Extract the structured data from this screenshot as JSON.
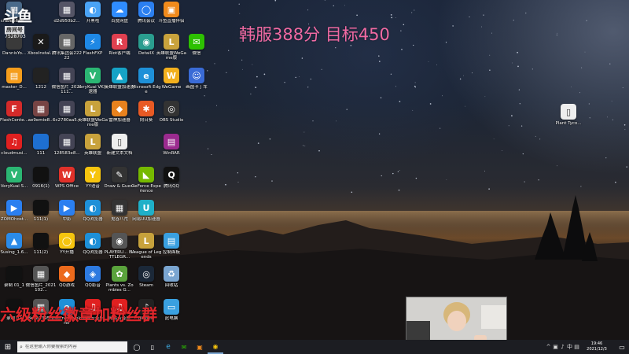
{
  "overlay": {
    "logo_text": "斗鱼",
    "room_label": "房间号",
    "room_id": "7528703",
    "rank_goal": "韩服388分  目标450",
    "fan_group": "六级粉丝徽章加粉丝群"
  },
  "desktop_icons": [
    {
      "label": "Dannis",
      "glyph": "",
      "color": "#3a3a3a"
    },
    {
      "label": "d2d950b2...",
      "glyph": "▦",
      "color": "#556"
    },
    {
      "label": "开黑啦",
      "glyph": "◐",
      "color": "#4aa3f5"
    },
    {
      "label": "百度网盘",
      "glyph": "☁",
      "color": "#2f8cff"
    },
    {
      "label": "腾讯会议",
      "glyph": "◯",
      "color": "#2b7ff0"
    },
    {
      "label": "斗鱼直播伴侣",
      "glyph": "▣",
      "color": "#f08a1c"
    },
    {
      "label": "DannisYo...",
      "glyph": "",
      "color": "#3a3a3a"
    },
    {
      "label": "XboxInstal...",
      "glyph": "✕",
      "color": "#1a1a1a"
    },
    {
      "label": "腾讯集团会22222",
      "glyph": "▦",
      "color": "#666"
    },
    {
      "label": "FlashFXP",
      "glyph": "⚡",
      "color": "#1e88e5"
    },
    {
      "label": "Riot客户端",
      "glyph": "R",
      "color": "#e04050"
    },
    {
      "label": "DetailX",
      "glyph": "◉",
      "color": "#2a9d8f"
    },
    {
      "label": "英雄联盟WeGame版",
      "glyph": "L",
      "color": "#c8a23c"
    },
    {
      "label": "微信",
      "glyph": "✉",
      "color": "#2dc100"
    },
    {
      "label": "master_D...",
      "glyph": "▤",
      "color": "#f59d1c"
    },
    {
      "label": "1212",
      "glyph": "",
      "color": "#222"
    },
    {
      "label": "微信图片_2021111...",
      "glyph": "▦",
      "color": "#445"
    },
    {
      "label": "VeryKuai VK加速器",
      "glyph": "V",
      "color": "#2bb673"
    },
    {
      "label": "英雄联盟加速器",
      "glyph": "▲",
      "color": "#16a3c6"
    },
    {
      "label": "Microsoft Edge",
      "glyph": "e",
      "color": "#1e90d8"
    },
    {
      "label": "WeGame",
      "glyph": "W",
      "color": "#f2b01e"
    },
    {
      "label": "画图卡丁车",
      "glyph": "☺",
      "color": "#3a6bd6"
    },
    {
      "label": "FlashCente...",
      "glyph": "F",
      "color": "#d42a2a"
    },
    {
      "label": "ae9emie8...",
      "glyph": "▦",
      "color": "#744"
    },
    {
      "label": "6c2780aa5...",
      "glyph": "▦",
      "color": "#445"
    },
    {
      "label": "英雄联盟WeGame版",
      "glyph": "L",
      "color": "#c8a23c"
    },
    {
      "label": "雷神加速器",
      "glyph": "◆",
      "color": "#e8821e"
    },
    {
      "label": "向日葵",
      "glyph": "✱",
      "color": "#e85a24"
    },
    {
      "label": "OBS Studio",
      "glyph": "◎",
      "color": "#333"
    },
    {
      "label": "cloudmusi...",
      "glyph": "♫",
      "color": "#e02020"
    },
    {
      "label": "111",
      "glyph": "",
      "color": "#1e6fd0"
    },
    {
      "label": "128583e8...",
      "glyph": "▦",
      "color": "#445"
    },
    {
      "label": "英雄联盟",
      "glyph": "L",
      "color": "#c8a23c"
    },
    {
      "label": "新建文本文档",
      "glyph": "▯",
      "color": "#eee"
    },
    {
      "label": "WinRAR",
      "glyph": "▤",
      "color": "#9b2b8f"
    },
    {
      "label": "VeryKuai S...",
      "glyph": "V",
      "color": "#2bb673"
    },
    {
      "label": "0916(1)",
      "glyph": "",
      "color": "#111"
    },
    {
      "label": "WPS Office",
      "glyph": "W",
      "color": "#e0312a"
    },
    {
      "label": "YY语音",
      "glyph": "Y",
      "color": "#f6c40e"
    },
    {
      "label": "Draw & Guess",
      "glyph": "✎",
      "color": "#333"
    },
    {
      "label": "GeForce Experience",
      "glyph": "◣",
      "color": "#76b900"
    },
    {
      "label": "腾讯QQ",
      "glyph": "Q",
      "color": "#111"
    },
    {
      "label": "ZOMOhost...",
      "glyph": "▶",
      "color": "#2b7ff0"
    },
    {
      "label": "111(1)",
      "glyph": "",
      "color": "#111"
    },
    {
      "label": "中影",
      "glyph": "▶",
      "color": "#2b7ff0"
    },
    {
      "label": "QQ浏览器",
      "glyph": "◐",
      "color": "#1e90d8"
    },
    {
      "label": "鬼谷八荒",
      "glyph": "▦",
      "color": "#333"
    },
    {
      "label": "网易UU加速器",
      "glyph": "U",
      "color": "#1fb0c8"
    },
    {
      "label": "Susing_1.6...",
      "glyph": "▲",
      "color": "#2b8be8"
    },
    {
      "label": "111(2)",
      "glyph": "",
      "color": "#111"
    },
    {
      "label": "YY开播",
      "glyph": "◯",
      "color": "#f6c40e"
    },
    {
      "label": "QQ浏览器",
      "glyph": "◐",
      "color": "#1e90d8"
    },
    {
      "label": "PLAYERU... BATTLEGR...",
      "glyph": "◉",
      "color": "#555"
    },
    {
      "label": "League of Legends",
      "glyph": "L",
      "color": "#c8a23c"
    },
    {
      "label": "控制面板",
      "glyph": "▤",
      "color": "#3aa0e0"
    },
    {
      "label": "录制 01_1",
      "glyph": "",
      "color": "#111"
    },
    {
      "label": "微信图片_2021102...",
      "glyph": "▦",
      "color": "#555"
    },
    {
      "label": "QQ游戏",
      "glyph": "◆",
      "color": "#ec6a1c"
    },
    {
      "label": "QQ影音",
      "glyph": "◈",
      "color": "#2d7ae0"
    },
    {
      "label": "Plants vs. Zombies G...",
      "glyph": "✿",
      "color": "#5aa33c"
    },
    {
      "label": "Steam",
      "glyph": "◎",
      "color": "#1b2838"
    },
    {
      "label": "回收站",
      "glyph": "♻",
      "color": "#7aa5d0"
    },
    {
      "label": "录制 01",
      "glyph": "",
      "color": "#111"
    },
    {
      "label": "8e1b2395...",
      "glyph": "▦",
      "color": "#555"
    },
    {
      "label": "Internet Explorer",
      "glyph": "e",
      "color": "#1e90d8"
    },
    {
      "label": "网易云音乐",
      "glyph": "♫",
      "color": "#e02020"
    },
    {
      "label": "网易云音乐",
      "glyph": "♫",
      "color": "#e02020"
    },
    {
      "label": "tiktokie",
      "glyph": "♪",
      "color": "#222"
    },
    {
      "label": "此电脑",
      "glyph": "▭",
      "color": "#3aa0e0"
    },
    {
      "label": "cfa9e66ae...",
      "glyph": "▦",
      "color": "#4a6a8a"
    },
    {
      "label": "Plant Tyco...",
      "glyph": "▯",
      "color": "#eee"
    }
  ],
  "taskbar": {
    "start_icon": "⊞",
    "search_placeholder": "在这里输入你要搜索的内容",
    "clock_time": "19:46",
    "clock_date": "2021/12/3",
    "tray": [
      "^",
      "▣",
      "♪",
      "中",
      "▤"
    ],
    "pinned": [
      "◯",
      "▯",
      "e",
      "✉",
      "▣",
      "◉"
    ]
  }
}
